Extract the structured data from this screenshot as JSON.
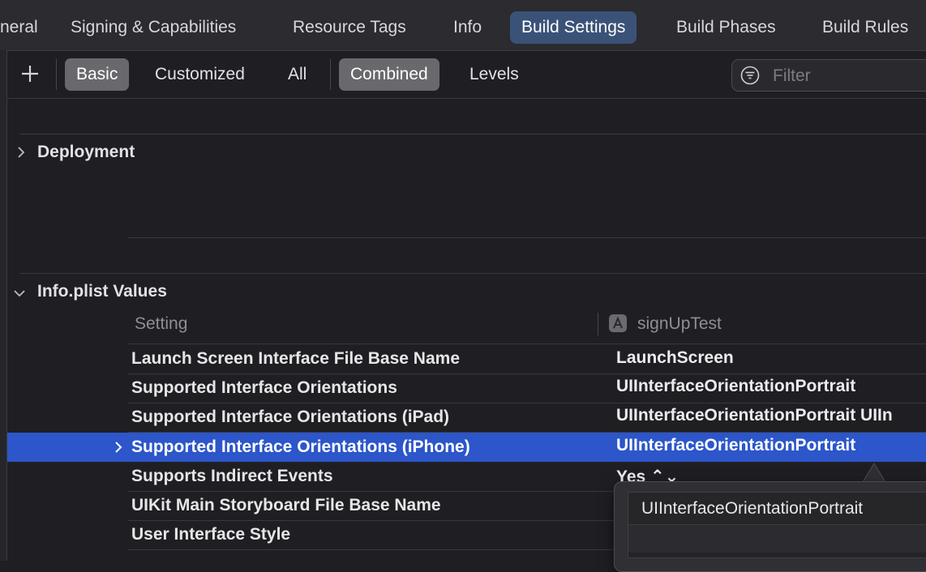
{
  "tabs": [
    {
      "label": "neral",
      "active": false
    },
    {
      "label": "Signing & Capabilities",
      "active": false
    },
    {
      "label": "Resource Tags",
      "active": false
    },
    {
      "label": "Info",
      "active": false
    },
    {
      "label": "Build Settings",
      "active": true
    },
    {
      "label": "Build Phases",
      "active": false
    },
    {
      "label": "Build Rules",
      "active": false
    }
  ],
  "toolbar": {
    "add_icon": "plus-icon",
    "basic": "Basic",
    "customized": "Customized",
    "all": "All",
    "combined": "Combined",
    "levels": "Levels",
    "filter_placeholder": "Filter",
    "filter_icon": "filter-icon"
  },
  "sections": {
    "deployment": {
      "title": "Deployment",
      "expanded": false
    },
    "info_plist": {
      "title": "Info.plist Values",
      "expanded": true
    }
  },
  "columns": {
    "setting": "Setting",
    "target": "signUpTest",
    "target_icon": "app-target-icon"
  },
  "rows": [
    {
      "label": "Launch Screen Interface File Base Name",
      "value": "LaunchScreen"
    },
    {
      "label": "Supported Interface Orientations",
      "value": "UIInterfaceOrientationPortrait"
    },
    {
      "label": "Supported Interface Orientations (iPad)",
      "value": "UIInterfaceOrientationPortrait UIIn"
    },
    {
      "label": "Supported Interface Orientations (iPhone)",
      "value": "UIInterfaceOrientationPortrait",
      "selected": true
    },
    {
      "label": "Supports Indirect Events",
      "value": "Yes ⌃⌄"
    },
    {
      "label": "UIKit Main Storyboard File Base Name",
      "value": ""
    },
    {
      "label": "User Interface Style",
      "value": ""
    }
  ],
  "popover": {
    "items": [
      "UIInterfaceOrientationPortrait"
    ]
  },
  "colors": {
    "active_tab": "#3b5278",
    "selection": "#2c56c9",
    "segment_on": "#69696d"
  }
}
